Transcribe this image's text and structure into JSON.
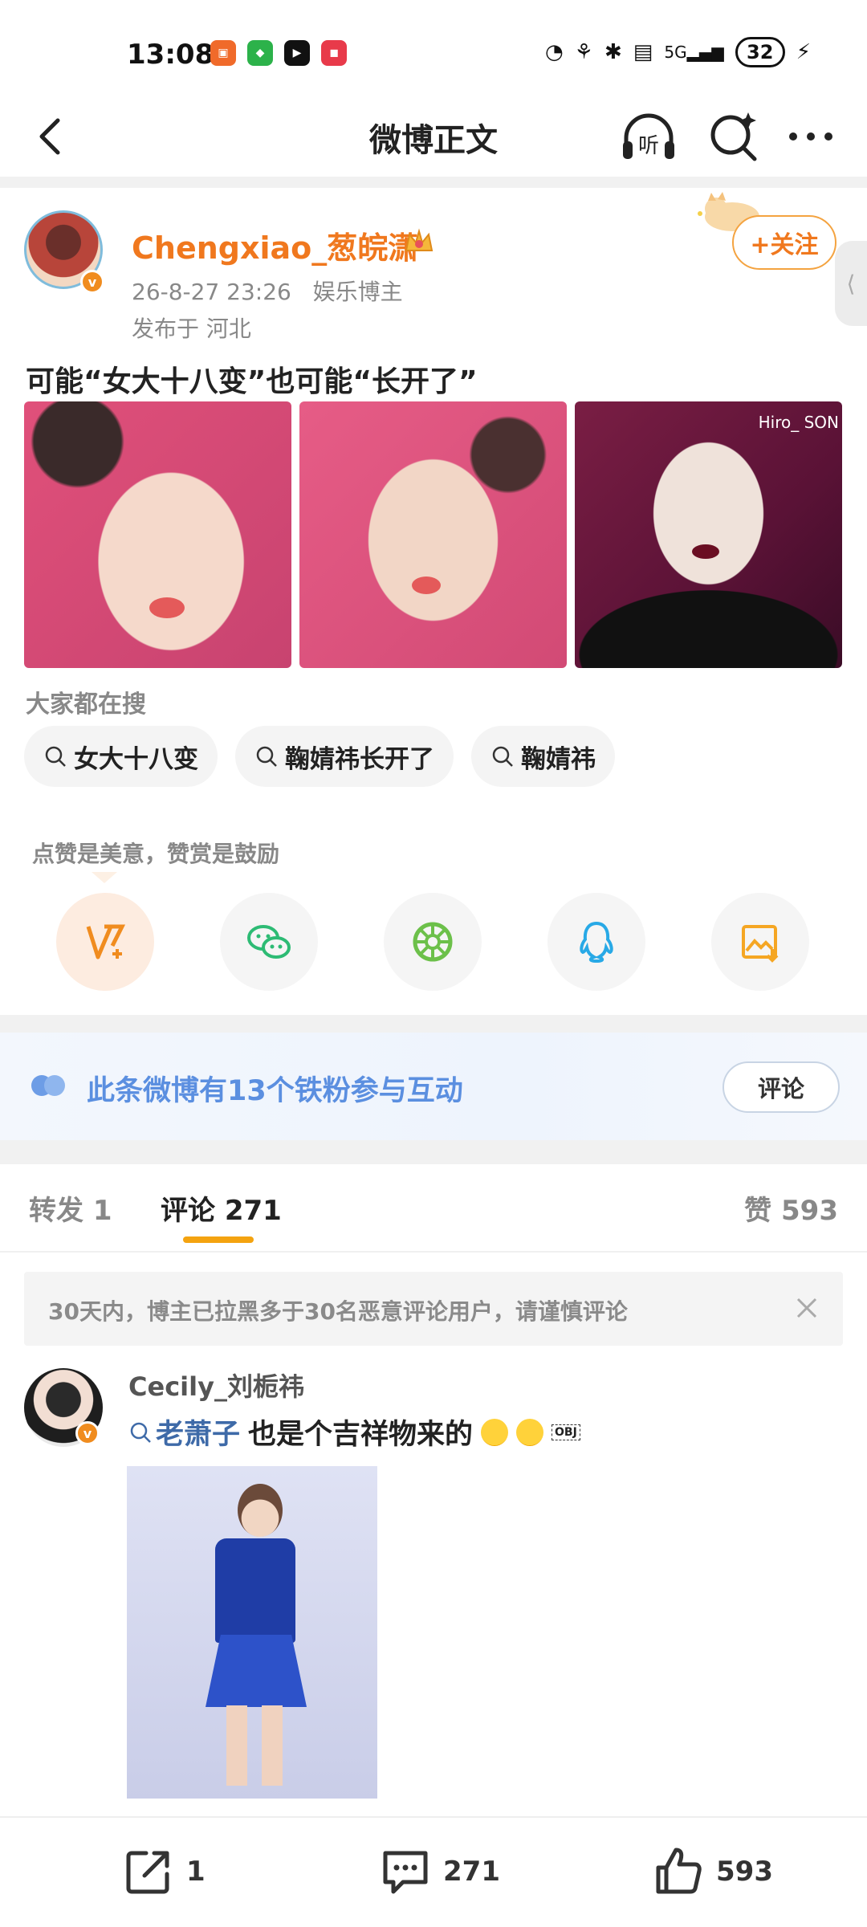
{
  "status_bar": {
    "time": "13:08",
    "battery": "32",
    "signal_label": "5G"
  },
  "nav": {
    "title": "微博正文",
    "listen_label": "听"
  },
  "post": {
    "user_name": "Chengxiao_葱皖潇",
    "timestamp": "26-8-27 23:26",
    "user_type": "娱乐博主",
    "location": "发布于 河北",
    "follow_label": "+关注",
    "text": "可能“女大十八变”也可能“长开了”",
    "photo_watermark": "Hiro_ SON"
  },
  "search": {
    "title": "大家都在搜",
    "chips": [
      "女大十八变",
      "鞠婧祎长开了",
      "鞠婧祎"
    ]
  },
  "share": {
    "hint": "点赞是美意，赞赏是鼓励",
    "buttons": [
      "reward-icon",
      "wechat-icon",
      "moments-icon",
      "qq-icon",
      "save-image-icon"
    ]
  },
  "fans_banner": {
    "text": "此条微博有13个铁粉参与互动",
    "button": "评论"
  },
  "tabs": {
    "repost": "转发",
    "repost_count": "1",
    "comment": "评论",
    "comment_count": "271",
    "like": "赞",
    "like_count": "593"
  },
  "notice": {
    "text": "30天内，博主已拉黑多于30名恶意评论用户，请谨慎评论"
  },
  "comment": {
    "user_name": "Cecily_刘栀祎",
    "link": "老萧子",
    "text": "也是个吉祥物来的",
    "obj": "OBJ"
  },
  "bottom_bar": {
    "repost_count": "1",
    "comment_count": "271",
    "like_count": "593"
  },
  "colors": {
    "accent_orange": "#f0781e",
    "tab_underline": "#f4a310",
    "link_blue": "#3e6aa8",
    "fans_blue": "#5b8fe0"
  }
}
